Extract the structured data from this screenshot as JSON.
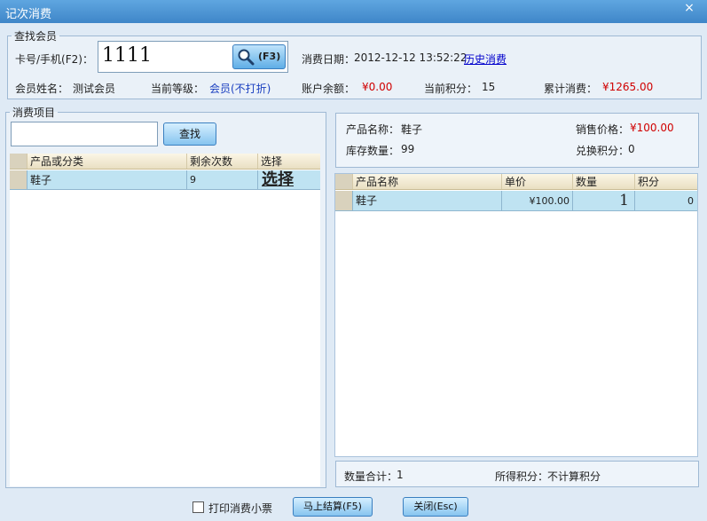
{
  "window": {
    "title": "记次消费",
    "close_glyph": "×"
  },
  "member_search": {
    "legend": "查找会员",
    "card_label": "卡号/手机(F2)：",
    "card_value": "1111",
    "search_button": "(F3)",
    "date_label": "消费日期：",
    "date_value": "2012-12-12 13:52:22",
    "history_link": "历史消费",
    "name_label": "会员姓名：",
    "name_value": "测试会员",
    "level_label": "当前等级：",
    "level_value": "会员(不打折)",
    "balance_label": "账户余额：",
    "balance_value": "¥0.00",
    "points_label": "当前积分：",
    "points_value": "15",
    "total_label": "累计消费：",
    "total_value": "¥1265.00"
  },
  "items": {
    "legend": "消费项目",
    "search_value": "",
    "search_button": "查找",
    "columns": [
      "产品或分类",
      "剩余次数",
      "选择"
    ],
    "rows": [
      {
        "name": "鞋子",
        "remaining": "9",
        "select": "选择"
      }
    ]
  },
  "product_info": {
    "name_label": "产品名称：",
    "name_value": "鞋子",
    "price_label": "销售价格：",
    "price_value": "¥100.00",
    "stock_label": "库存数量：",
    "stock_value": "99",
    "exchange_label": "兑换积分：",
    "exchange_value": "0"
  },
  "cart": {
    "columns": [
      "产品名称",
      "单价",
      "数量",
      "积分"
    ],
    "rows": [
      {
        "name": "鞋子",
        "price": "¥100.00",
        "qty": "1",
        "points": "0"
      }
    ]
  },
  "summary": {
    "qty_label": "数量合计：",
    "qty_value": "1",
    "points_label": "所得积分：",
    "points_value": "不计算积分"
  },
  "footer": {
    "print_label": "打印消费小票",
    "print_checked": false,
    "checkout_button": "马上结算(F5)",
    "close_button": "关闭(Esc)"
  },
  "colors": {
    "accent": "#3f86c8",
    "money": "#d00000",
    "selected_row": "#bfe3f2"
  }
}
